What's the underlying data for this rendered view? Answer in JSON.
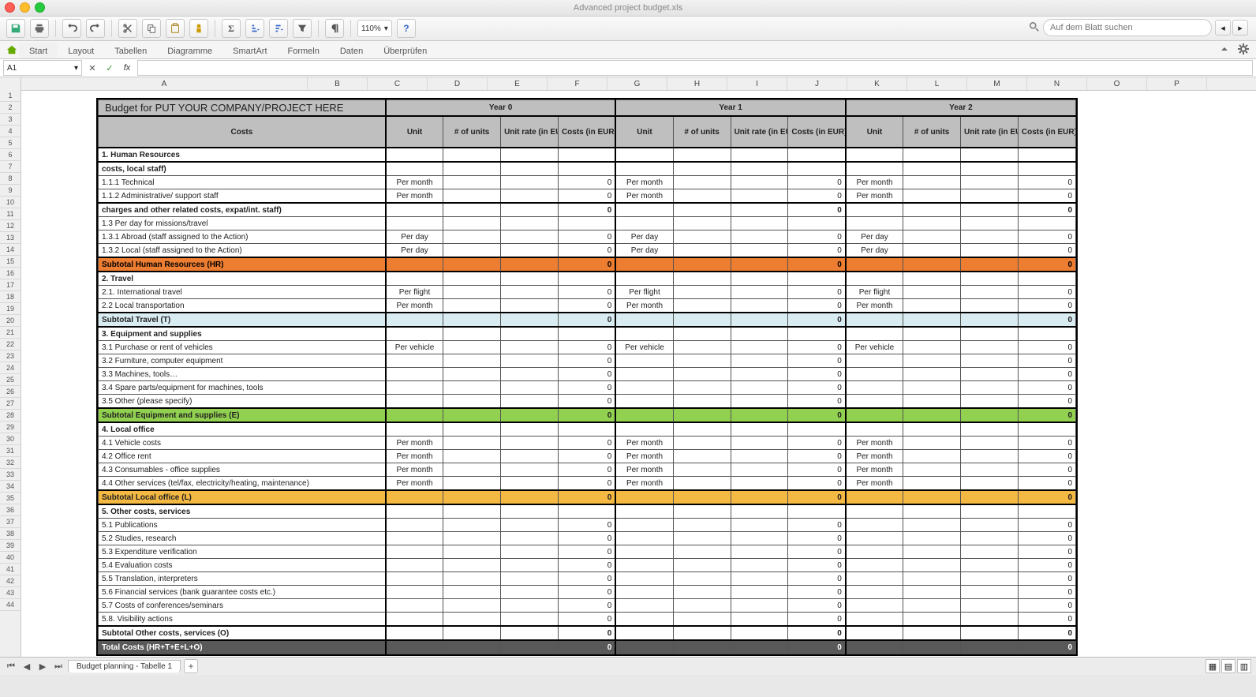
{
  "window": {
    "title": "Advanced project budget.xls"
  },
  "toolbar": {
    "zoom": "110%"
  },
  "search": {
    "placeholder": "Auf dem Blatt suchen"
  },
  "ribbon": {
    "tabs": [
      "Start",
      "Layout",
      "Tabellen",
      "Diagramme",
      "SmartArt",
      "Formeln",
      "Daten",
      "Überprüfen"
    ]
  },
  "namebox": {
    "ref": "A1",
    "formula": ""
  },
  "columns": [
    "A",
    "B",
    "C",
    "D",
    "E",
    "F",
    "G",
    "H",
    "I",
    "J",
    "K",
    "L",
    "M",
    "N",
    "O",
    "P"
  ],
  "rownums": [
    "1",
    "2",
    "3",
    "4",
    "5",
    "6",
    "7",
    "8",
    "9",
    "10",
    "11",
    "12",
    "13",
    "14",
    "15",
    "16",
    "17",
    "18",
    "19",
    "20",
    "21",
    "22",
    "23",
    "24",
    "25",
    "26",
    "27",
    "28",
    "29",
    "30",
    "31",
    "32",
    "33",
    "34",
    "35",
    "36",
    "37",
    "38",
    "39",
    "40",
    "41",
    "42",
    "43",
    "44"
  ],
  "sheet": {
    "tab": "Budget planning - Tabelle 1"
  },
  "budget": {
    "title": "Budget for PUT YOUR COMPANY/PROJECT HERE",
    "yearLabels": [
      "Year 0",
      "Year 1",
      "Year 2"
    ],
    "subheaders": {
      "costs": "Costs",
      "unit": "Unit",
      "nunits": "# of units",
      "rate": "Unit rate (in EUR)",
      "cost": "Costs (in EUR)",
      "rate2": "Unit rate (in EUR)"
    },
    "rows": [
      {
        "type": "section",
        "label": "1. Human Resources"
      },
      {
        "type": "section",
        "label": "costs, local staff)"
      },
      {
        "type": "line",
        "label": "   1.1.1 Technical",
        "unit": "Per month",
        "c0": "0",
        "u1": "Per month",
        "c1": "0",
        "u2": "Per month",
        "c2": "0"
      },
      {
        "type": "line",
        "label": "   1.1.2 Administrative/ support staff",
        "unit": "Per month",
        "c0": "0",
        "u1": "Per month",
        "c1": "0",
        "u2": "Per month",
        "c2": "0"
      },
      {
        "type": "section",
        "label": "charges and other related costs, expat/int. staff)",
        "c0": "0",
        "c1": "0",
        "c2": "0"
      },
      {
        "type": "line",
        "label": "   1.3 Per day for missions/travel"
      },
      {
        "type": "line",
        "label": "   1.3.1 Abroad (staff assigned to the Action)",
        "unit": "Per day",
        "c0": "0",
        "u1": "Per day",
        "c1": "0",
        "u2": "Per day",
        "c2": "0"
      },
      {
        "type": "line",
        "label": "   1.3.2 Local (staff assigned to the Action)",
        "unit": "Per day",
        "c0": "0",
        "u1": "Per day",
        "c1": "0",
        "u2": "Per day",
        "c2": "0"
      },
      {
        "type": "subtotal",
        "style": "orange",
        "label": "Subtotal Human Resources (HR)",
        "c0": "0",
        "c1": "0",
        "c2": "0"
      },
      {
        "type": "section",
        "label": "2. Travel"
      },
      {
        "type": "line",
        "label": "2.1. International travel",
        "unit": "Per flight",
        "c0": "0",
        "u1": "Per flight",
        "c1": "0",
        "u2": "Per flight",
        "c2": "0"
      },
      {
        "type": "line",
        "label": "2.2 Local transportation",
        "unit": "Per month",
        "c0": "0",
        "u1": "Per month",
        "c1": "0",
        "u2": "Per month",
        "c2": "0"
      },
      {
        "type": "subtotal",
        "style": "blue",
        "label": "Subtotal Travel (T)",
        "c0": "0",
        "c1": "0",
        "c2": "0"
      },
      {
        "type": "section",
        "label": "3. Equipment and supplies"
      },
      {
        "type": "line",
        "label": "3.1 Purchase or rent of vehicles",
        "unit": "Per vehicle",
        "c0": "0",
        "u1": "Per vehicle",
        "c1": "0",
        "u2": "Per vehicle",
        "c2": "0"
      },
      {
        "type": "line",
        "label": "3.2 Furniture, computer equipment",
        "c0": "0",
        "c1": "0",
        "c2": "0"
      },
      {
        "type": "line",
        "label": "3.3 Machines, tools…",
        "c0": "0",
        "c1": "0",
        "c2": "0"
      },
      {
        "type": "line",
        "label": "3.4 Spare parts/equipment for machines, tools",
        "c0": "0",
        "c1": "0",
        "c2": "0"
      },
      {
        "type": "line",
        "label": "3.5 Other (please specify)",
        "c0": "0",
        "c1": "0",
        "c2": "0"
      },
      {
        "type": "subtotal",
        "style": "green",
        "label": "Subtotal Equipment and supplies (E)",
        "c0": "0",
        "c1": "0",
        "c2": "0"
      },
      {
        "type": "section",
        "label": "4. Local office"
      },
      {
        "type": "line",
        "label": "4.1 Vehicle costs",
        "unit": "Per month",
        "c0": "0",
        "u1": "Per month",
        "c1": "0",
        "u2": "Per month",
        "c2": "0"
      },
      {
        "type": "line",
        "label": "4.2 Office rent",
        "unit": "Per month",
        "c0": "0",
        "u1": "Per month",
        "c1": "0",
        "u2": "Per month",
        "c2": "0"
      },
      {
        "type": "line",
        "label": "4.3 Consumables - office supplies",
        "unit": "Per month",
        "c0": "0",
        "u1": "Per month",
        "c1": "0",
        "u2": "Per month",
        "c2": "0"
      },
      {
        "type": "line",
        "label": "4.4 Other services (tel/fax, electricity/heating, maintenance)",
        "unit": "Per month",
        "c0": "0",
        "u1": "Per month",
        "c1": "0",
        "u2": "Per month",
        "c2": "0"
      },
      {
        "type": "subtotal",
        "style": "amber",
        "label": "Subtotal Local office (L)",
        "c0": "0",
        "c1": "0",
        "c2": "0"
      },
      {
        "type": "section",
        "label": "5. Other costs, services"
      },
      {
        "type": "line",
        "label": "5.1 Publications",
        "c0": "0",
        "c1": "0",
        "c2": "0"
      },
      {
        "type": "line",
        "label": "5.2 Studies, research",
        "c0": "0",
        "c1": "0",
        "c2": "0"
      },
      {
        "type": "line",
        "label": "5.3 Expenditure verification",
        "c0": "0",
        "c1": "0",
        "c2": "0"
      },
      {
        "type": "line",
        "label": "5.4 Evaluation costs",
        "c0": "0",
        "c1": "0",
        "c2": "0"
      },
      {
        "type": "line",
        "label": "5.5 Translation, interpreters",
        "c0": "0",
        "c1": "0",
        "c2": "0"
      },
      {
        "type": "line",
        "label": "5.6 Financial services (bank guarantee costs etc.)",
        "c0": "0",
        "c1": "0",
        "c2": "0"
      },
      {
        "type": "line",
        "label": "5.7 Costs of conferences/seminars",
        "c0": "0",
        "c1": "0",
        "c2": "0"
      },
      {
        "type": "line",
        "label": "5.8. Visibility actions",
        "c0": "0",
        "c1": "0",
        "c2": "0"
      },
      {
        "type": "subtotal",
        "style": "white",
        "label": "Subtotal Other costs, services (O)",
        "c0": "0",
        "c1": "0",
        "c2": "0"
      },
      {
        "type": "total",
        "label": "Total Costs (HR+T+E+L+O)",
        "c0": "0",
        "c1": "0",
        "c2": "0"
      }
    ]
  }
}
